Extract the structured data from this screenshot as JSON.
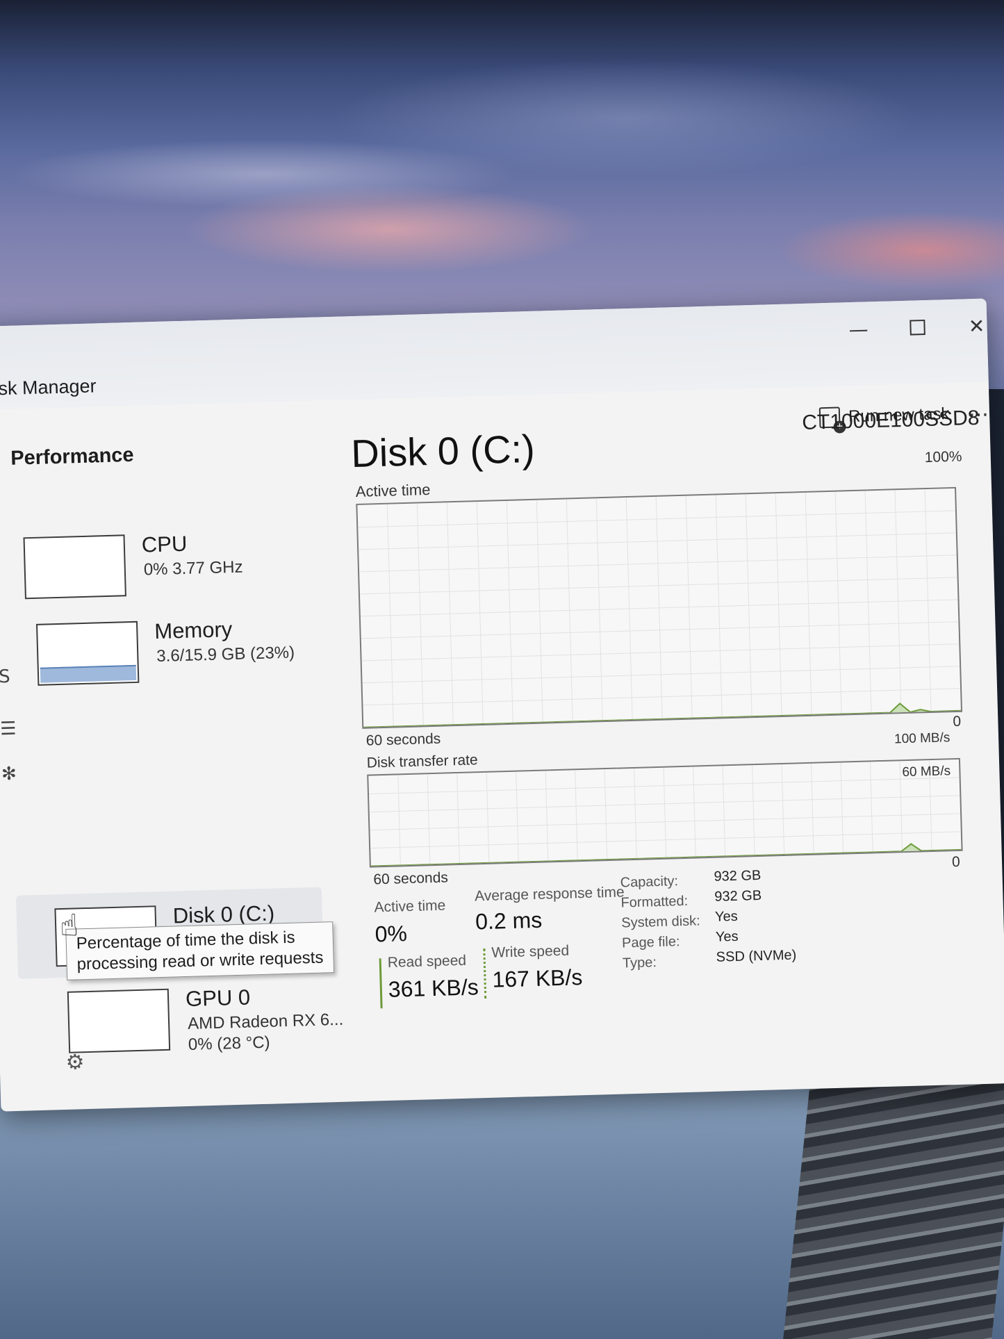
{
  "window": {
    "title": "ask Manager"
  },
  "toolbar": {
    "section_title": "Performance",
    "run_new_task_label": "Run new task",
    "more_label": "..."
  },
  "devices": [
    {
      "name": "CPU",
      "sub": "0% 3.77 GHz",
      "sub2": "",
      "usage_fraction": 0.0
    },
    {
      "name": "Memory",
      "sub": "3.6/15.9 GB (23%)",
      "sub2": "",
      "usage_fraction": 0.23
    },
    {
      "name": "Disk 0 (C:)",
      "sub": "",
      "sub2": "",
      "usage_fraction": 0.0
    },
    {
      "name": "GPU 0",
      "sub": "AMD Radeon RX 6...",
      "sub2": "0% (28 °C)",
      "usage_fraction": 0.0
    }
  ],
  "tooltip": {
    "line1": "Percentage of time the disk is",
    "line2": "processing read or write requests"
  },
  "detail": {
    "title": "Disk 0 (C:)",
    "model": "CT1000E100SSD8",
    "active_time_chart": {
      "label": "Active time",
      "max_label": "100%",
      "min_label": "0",
      "duration_label": "60 seconds"
    },
    "transfer_chart": {
      "label": "Disk transfer rate",
      "max_label": "100 MB/s",
      "mid_label": "60 MB/s",
      "min_label": "0",
      "duration_label": "60 seconds"
    },
    "stats": {
      "active_time_label": "Active time",
      "active_time_value": "0%",
      "avg_response_label": "Average response time",
      "avg_response_value": "0.2 ms",
      "read_label": "Read speed",
      "read_value": "361 KB/s",
      "write_label": "Write speed",
      "write_value": "167 KB/s"
    },
    "properties": [
      {
        "label": "Capacity:",
        "value": "932 GB"
      },
      {
        "label": "Formatted:",
        "value": "932 GB"
      },
      {
        "label": "System disk:",
        "value": "Yes"
      },
      {
        "label": "Page file:",
        "value": "Yes"
      },
      {
        "label": "Type:",
        "value": "SSD (NVMe)"
      }
    ]
  },
  "colors": {
    "disk_accent": "#6d9a3a",
    "disk_fill": "#b6d59a",
    "memory_fill": "#9fb9dc"
  },
  "chart_data": {
    "type": "area",
    "active_time_percent": [
      0,
      0,
      0,
      0,
      0,
      0,
      0,
      0,
      0,
      0,
      0,
      0,
      0,
      0,
      0,
      0,
      0,
      0,
      0,
      0,
      0,
      0,
      0,
      0,
      0,
      0,
      0,
      0,
      0,
      0,
      0,
      0,
      0,
      0,
      0,
      0,
      0,
      0,
      0,
      0,
      0,
      0,
      0,
      0,
      0,
      0,
      0,
      0,
      0,
      0,
      0,
      0,
      0,
      4,
      0,
      1,
      0,
      0,
      0,
      0
    ],
    "transfer_mbps": [
      0,
      0,
      0,
      0,
      0,
      0,
      0,
      0,
      0,
      0,
      0,
      0,
      0,
      0,
      0,
      0,
      0,
      0,
      0,
      0,
      0,
      0,
      0,
      0,
      0,
      0,
      0,
      0,
      0,
      0,
      0,
      0,
      0,
      0,
      0,
      0,
      0,
      0,
      0,
      0,
      0,
      0,
      0,
      0,
      0,
      0,
      0,
      0,
      0,
      0,
      0,
      0,
      0,
      0,
      8,
      0,
      0,
      0,
      0,
      0
    ],
    "active_ylim": [
      0,
      100
    ],
    "transfer_ylim": [
      0,
      100
    ]
  }
}
